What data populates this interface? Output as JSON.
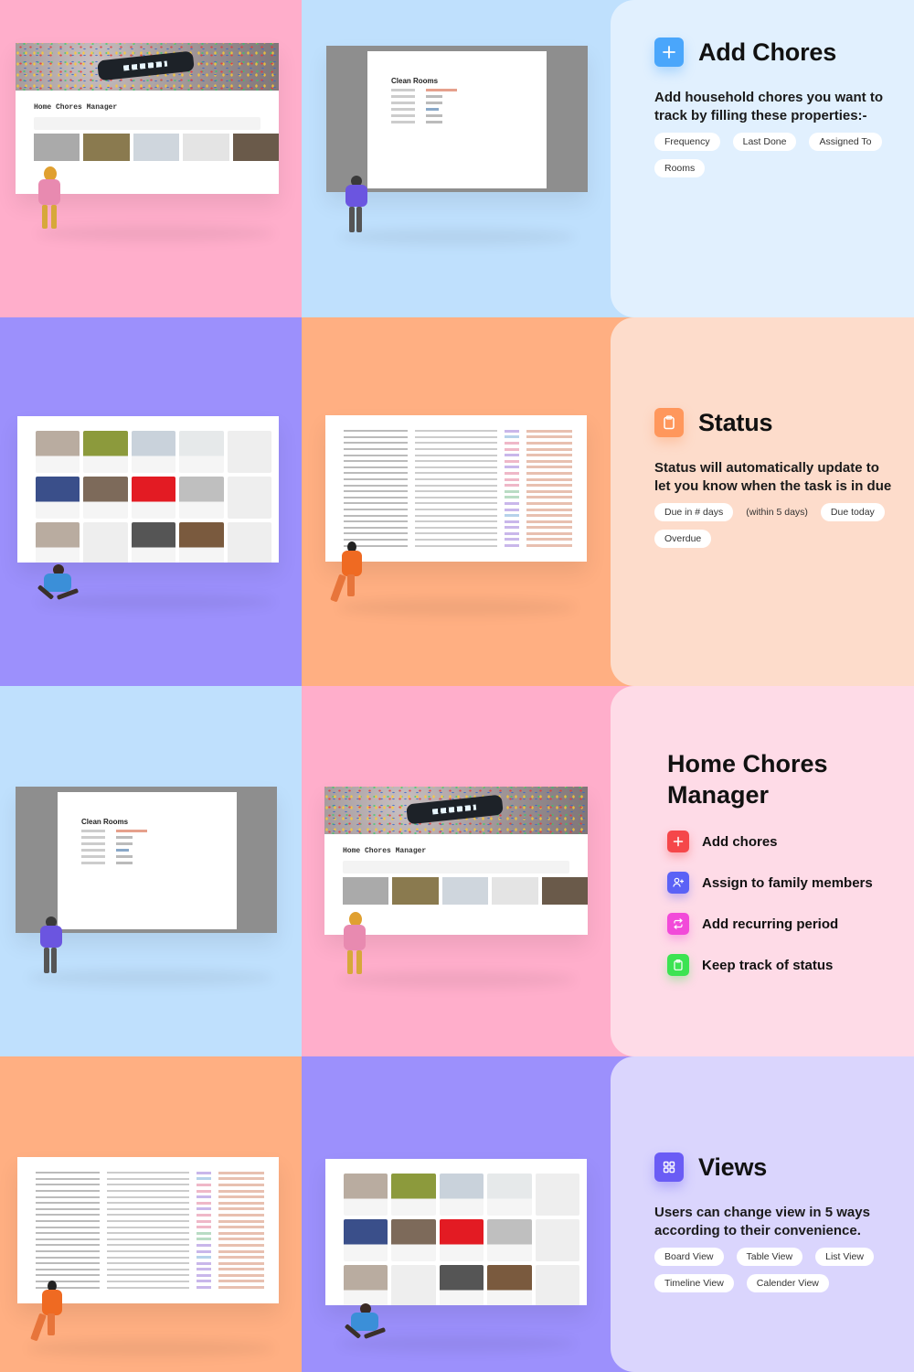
{
  "colors": {
    "pink": "#ffaecb",
    "blue": "#bfe0fd",
    "purple": "#9c90fc",
    "orange": "#ffaf82",
    "add_icon_blue": "#4aa6fb",
    "status_icon_orange": "#ff975c",
    "red_icon": "#f5474a",
    "indigo_icon": "#5b62f6",
    "magenta_icon": "#f24ad9",
    "green_icon": "#3ce352",
    "views_icon": "#6a5cf5"
  },
  "screens": {
    "home_page_title": "Home Chores Manager",
    "modal_title": "Clean Rooms"
  },
  "add_chores": {
    "icon": "plus-icon",
    "title": "Add Chores",
    "description": "Add household chores you want to track by filling these properties:-",
    "chips": [
      "Frequency",
      "Last Done",
      "Assigned To",
      "Rooms"
    ]
  },
  "status": {
    "icon": "clipboard-icon",
    "title": "Status",
    "description": "Status will automatically update to let you know when the task is in due",
    "chips": [
      "Due in # days",
      "Due today",
      "Overdue"
    ],
    "note": "(within 5 days)"
  },
  "manager": {
    "title_line1": "Home Chores",
    "title_line2": "Manager",
    "features": [
      {
        "icon": "plus-icon",
        "label": "Add chores"
      },
      {
        "icon": "user-add-icon",
        "label": "Assign to family members"
      },
      {
        "icon": "repeat-icon",
        "label": "Add recurring period"
      },
      {
        "icon": "clipboard-icon",
        "label": "Keep track of status"
      }
    ]
  },
  "views": {
    "icon": "grid-icon",
    "title": "Views",
    "description": "Users can change view in 5 ways according to their convenience.",
    "chips": [
      "Board View",
      "Table View",
      "List View",
      "Timeline View",
      "Calender View"
    ]
  }
}
